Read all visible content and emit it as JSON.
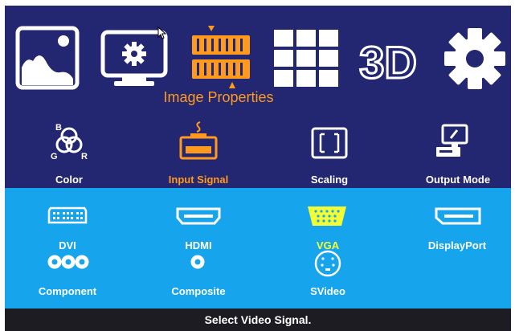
{
  "top_menu": {
    "items": [
      {
        "icon": "picture-icon"
      },
      {
        "icon": "monitor-settings-icon"
      },
      {
        "icon": "image-properties-icon",
        "label": "Image Properties",
        "selected": true
      },
      {
        "icon": "grid-layout-icon"
      },
      {
        "icon": "3d-icon",
        "text": "3D"
      },
      {
        "icon": "gear-icon"
      }
    ],
    "active_label": "Image Properties"
  },
  "sub_menu": {
    "items": [
      {
        "label": "Color",
        "icon": "rgb-color-icon",
        "letters": {
          "b": "B",
          "g": "G",
          "r": "R"
        }
      },
      {
        "label": "Input Signal",
        "icon": "input-connector-icon",
        "selected": true
      },
      {
        "label": "Scaling",
        "icon": "scaling-icon"
      },
      {
        "label": "Output Mode",
        "icon": "output-monitor-icon"
      }
    ]
  },
  "signals": {
    "items": [
      {
        "label": "DVI",
        "icon": "dvi-port-icon"
      },
      {
        "label": "HDMI",
        "icon": "hdmi-port-icon"
      },
      {
        "label": "VGA",
        "icon": "vga-port-icon",
        "selected": true
      },
      {
        "label": "DisplayPort",
        "icon": "displayport-icon"
      },
      {
        "label": "Component",
        "icon": "component-ports-icon"
      },
      {
        "label": "Composite",
        "icon": "composite-port-icon"
      },
      {
        "label": "SVideo",
        "icon": "svideo-port-icon"
      }
    ]
  },
  "status_text": "Select Video Signal.",
  "colors": {
    "top_bg": "#232670",
    "bottom_bg": "#16a5ec",
    "status_bg": "#1c1c22",
    "selected_orange": "#ff9a1f",
    "selected_yellow": "#f4ff33"
  }
}
